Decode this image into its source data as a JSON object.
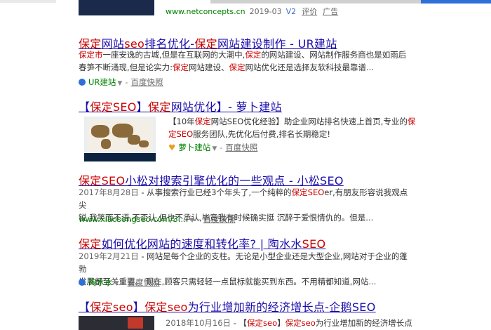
{
  "top_result": {
    "url": "www.netconcepts.cn",
    "date": "2019-03",
    "badge": "V2",
    "links": [
      "评价",
      "广告"
    ]
  },
  "results": [
    {
      "title_parts": [
        {
          "t": "保定",
          "hl": true
        },
        {
          "t": "网站",
          "hl": false
        },
        {
          "t": "seo",
          "hl": true
        },
        {
          "t": "排名优化-",
          "hl": false
        },
        {
          "t": "保定",
          "hl": true
        },
        {
          "t": "网站建设制作 - UR建站",
          "hl": false
        }
      ],
      "desc_lines": [
        [
          {
            "t": "保定市",
            "c": "hl"
          },
          {
            "t": "一座安逸的古城,但是在互联网的大潮中,",
            "c": ""
          },
          {
            "t": "保定",
            "c": "hl"
          },
          {
            "t": "的网站建设、网站制作服务商也是如雨后",
            "c": ""
          }
        ],
        [
          {
            "t": "春笋不断涌现,但是论实力:",
            "c": ""
          },
          {
            "t": "保定",
            "c": "hl"
          },
          {
            "t": "网站建设、",
            "c": ""
          },
          {
            "t": "保定",
            "c": "hl"
          },
          {
            "t": "网站优化还是选择友软科技最靠谱...",
            "c": ""
          }
        ]
      ],
      "source": "UR建站",
      "snapshot": "百度快照"
    },
    {
      "title_parts": [
        {
          "t": "【",
          "hl": false
        },
        {
          "t": "保定SEO",
          "hl": true
        },
        {
          "t": "】",
          "hl": false
        },
        {
          "t": "保定",
          "hl": true
        },
        {
          "t": "网站优化】- 萝卜建站",
          "hl": false
        }
      ],
      "desc_lines": [
        [
          {
            "t": "【10年",
            "c": ""
          },
          {
            "t": "保定",
            "c": "hl"
          },
          {
            "t": "网站SEO优化经验】助企业网站排名快速上首页,专业的",
            "c": ""
          },
          {
            "t": "保",
            "c": "hl"
          }
        ],
        [
          {
            "t": "定SEO",
            "c": "hl"
          },
          {
            "t": "服务团队,先优化后付费,排名长期稳定!",
            "c": ""
          }
        ]
      ],
      "source": "萝卜建站",
      "snapshot": "百度快照"
    },
    {
      "title_parts": [
        {
          "t": "保定SEO",
          "hl": true
        },
        {
          "t": "小松对搜索引擎优化的一些观点 - 小松SEO",
          "hl": false
        }
      ],
      "desc_lines": [
        [
          {
            "t": "2017年8月28日",
            "c": "gray"
          },
          {
            "t": " - 从事搜索行业已经3个年头了,一个纯粹的",
            "c": ""
          },
          {
            "t": "保定SEO",
            "c": "hl"
          },
          {
            "t": "er,有朋友形容说我观点尖",
            "c": ""
          }
        ],
        [
          {
            "t": "锐,我笑而不语,不否认,但也不承认,毕竟我有时候确实挺 沉醉于爱恨情仇的。但是...",
            "c": ""
          }
        ]
      ],
      "source": "www.xiaosongseo.com/3....",
      "snapshot": "百度快照"
    },
    {
      "title_parts": [
        {
          "t": "保定",
          "hl": true
        },
        {
          "t": "如何优化网站的速度和转化率? | 陶水水",
          "hl": false
        },
        {
          "t": "SEO",
          "hl": true
        }
      ],
      "desc_lines": [
        [
          {
            "t": "2019年2月21日",
            "c": "gray"
          },
          {
            "t": " - 网站是每个企业的支柱。无论是小型企业还是大型企业,网站对于企业的蓬勃",
            "c": ""
          }
        ],
        [
          {
            "t": "发展都至关重要。 现在,顾客只需轻轻一点鼠标就能买到东西。不用精都知道,网站...",
            "c": ""
          }
        ]
      ],
      "source": "陶水水",
      "snapshot": "百度快照"
    },
    {
      "title_parts": [
        {
          "t": "【",
          "hl": false
        },
        {
          "t": "保定seo",
          "hl": true
        },
        {
          "t": "】",
          "hl": false
        },
        {
          "t": "保定seo",
          "hl": true
        },
        {
          "t": "为行业增加新的经济增长点-企鹅SEO",
          "hl": false
        }
      ],
      "desc_line": [
        {
          "t": "2018年10月16日",
          "c": "gray"
        },
        {
          "t": " - 【",
          "c": ""
        },
        {
          "t": "保定seo",
          "c": "hl"
        },
        {
          "t": "】",
          "c": ""
        },
        {
          "t": "保定seo",
          "c": "hl"
        },
        {
          "t": "为行业增加新的经济增长点",
          "c": ""
        }
      ]
    }
  ],
  "colors": {
    "link": "#1a0dab",
    "highlight": "#cc0000",
    "url": "#008000",
    "meta": "#666666"
  }
}
